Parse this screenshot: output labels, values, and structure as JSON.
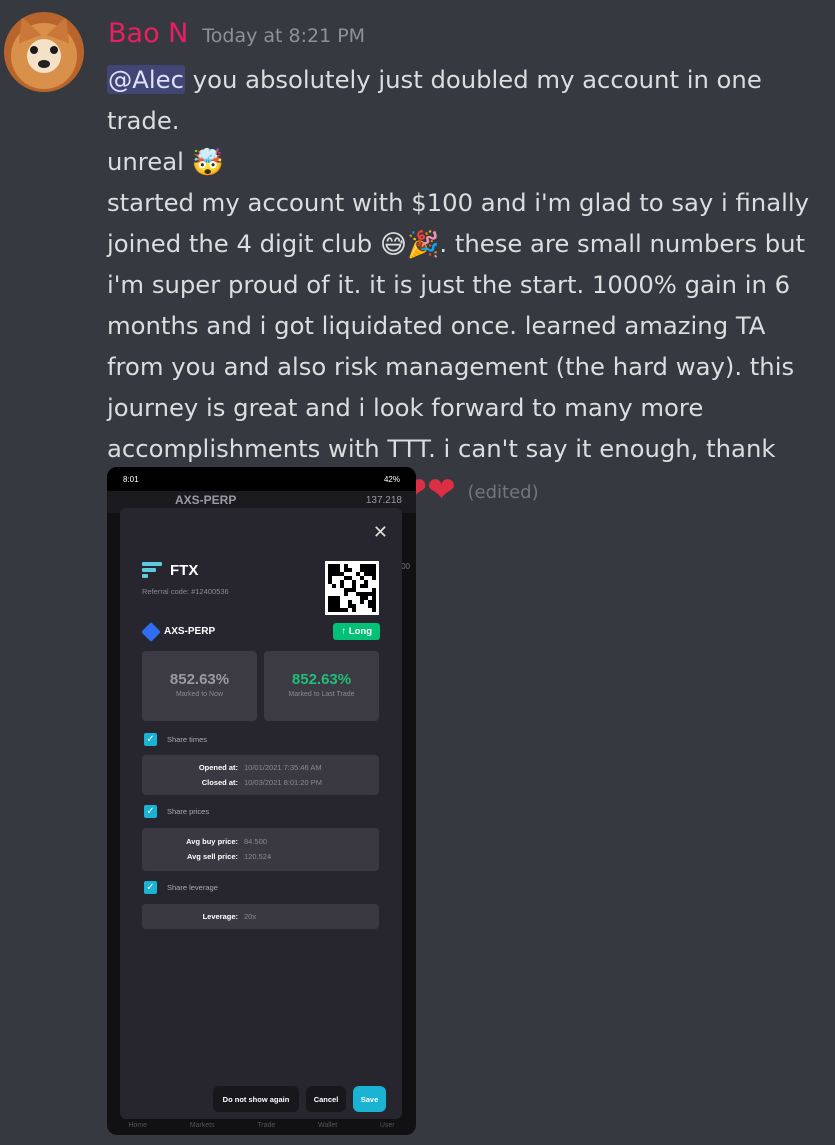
{
  "message": {
    "author": "Bao N",
    "timestamp": "Today at 8:21 PM",
    "mention": "@Alec",
    "line1_rest": " you absolutely just doubled my account in one trade.",
    "line2": "unreal",
    "body": "started my account with $100 and i'm glad to say i finally joined the 4 digit club",
    "body2": ". these are small numbers but i'm super proud of it. it is just the start. 1000% gain in 6 months and i got liquidated once. learned amazing TA from you and also risk management (the hard way). this journey is great and i look forward to many more accomplishments with TTT. i can't say it enough, thank you for everything Alec",
    "edited": "(edited)",
    "emoji_1": "🤯",
    "emoji_2": "😅🎉",
    "hearts": "❤❤"
  },
  "screenshot": {
    "status_time": "8:01",
    "status_right": "42%",
    "bg_pair": "AXS-PERP",
    "bg_price": "137.218",
    "bg_side_value": "00",
    "close_icon": "✕",
    "exchange": "FTX",
    "referral": "Referral code: #12400536",
    "pair": "AXS-PERP",
    "direction": "Long",
    "direction_arrow": "↑",
    "stat1_value": "852.63%",
    "stat1_label": "Marked to Now",
    "stat2_value": "852.63%",
    "stat2_label": "Marked to Last Trade",
    "checkmark": "✓",
    "share_times": "Share times",
    "opened_label": "Opened at:",
    "opened_value": "10/01/2021 7:35:46 AM",
    "closed_label": "Closed at:",
    "closed_value": "10/03/2021 8:01:20 PM",
    "share_prices": "Share prices",
    "avg_buy_label": "Avg buy price:",
    "avg_buy_value": "84.500",
    "avg_sell_label": "Avg sell price:",
    "avg_sell_value": "120.524",
    "share_leverage": "Share leverage",
    "leverage_label": "Leverage:",
    "leverage_value": "20x",
    "btn_dont_show": "Do not show again",
    "btn_cancel": "Cancel",
    "btn_save": "Save",
    "nav": [
      "Home",
      "Markets",
      "Trade",
      "Wallet",
      "User"
    ]
  },
  "colors": {
    "username": "#e91e63",
    "mention_bg": "#414675",
    "long_green": "#02c076",
    "accent_cyan": "#1ab3d4"
  }
}
